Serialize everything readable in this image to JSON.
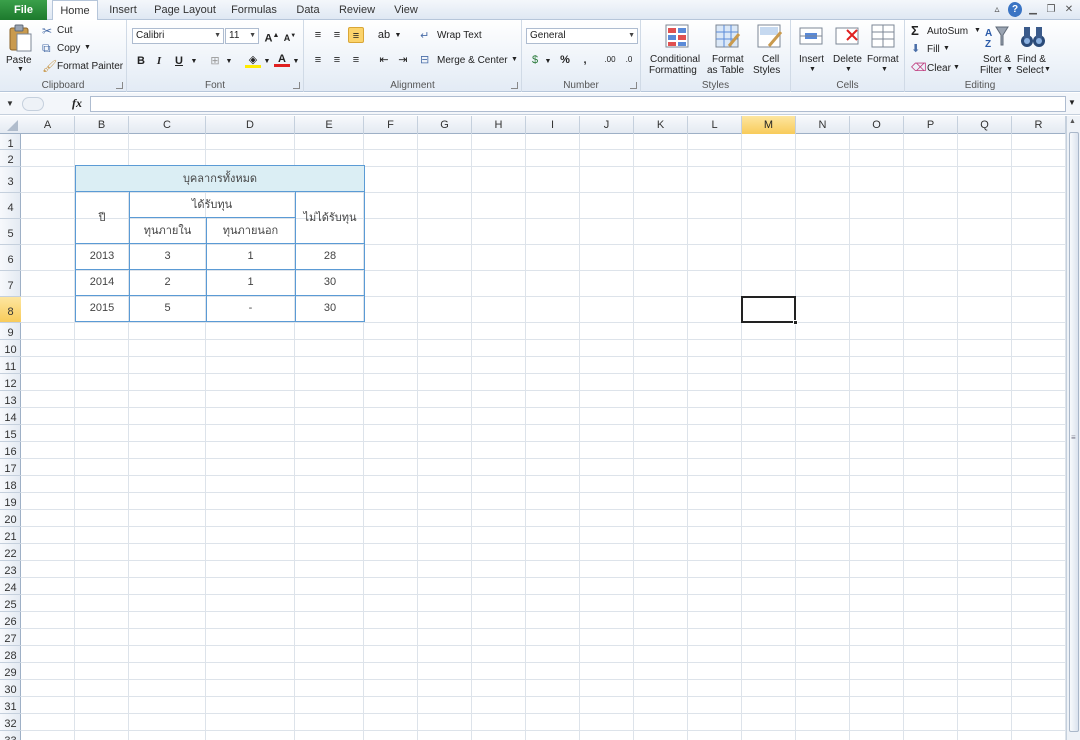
{
  "tabs": {
    "file": "File",
    "items": [
      "Home",
      "Insert",
      "Page Layout",
      "Formulas",
      "Data",
      "Review",
      "View"
    ]
  },
  "clipboard": {
    "paste": "Paste",
    "cut": "Cut",
    "copy": "Copy",
    "format_painter": "Format Painter",
    "label": "Clipboard"
  },
  "font": {
    "name": "Calibri",
    "size": "11",
    "label": "Font"
  },
  "alignment": {
    "wrap_text": "Wrap Text",
    "merge_center": "Merge & Center",
    "label": "Alignment"
  },
  "number": {
    "format": "General",
    "label": "Number"
  },
  "styles": {
    "conditional_1": "Conditional",
    "conditional_2": "Formatting",
    "format_table_1": "Format",
    "format_table_2": "as Table",
    "cell_styles_1": "Cell",
    "cell_styles_2": "Styles",
    "label": "Styles"
  },
  "cells_group": {
    "insert": "Insert",
    "delete": "Delete",
    "format": "Format",
    "label": "Cells"
  },
  "editing": {
    "autosum": "AutoSum",
    "fill": "Fill",
    "clear": "Clear",
    "sort_1": "Sort &",
    "sort_2": "Filter",
    "find_1": "Find &",
    "find_2": "Select",
    "label": "Editing"
  },
  "formula_bar": {
    "fx": "fx",
    "value": ""
  },
  "columns": [
    "A",
    "B",
    "C",
    "D",
    "E",
    "F",
    "G",
    "H",
    "I",
    "J",
    "K",
    "L",
    "M",
    "N",
    "O",
    "P",
    "Q",
    "R"
  ],
  "rows": [
    "1",
    "2",
    "3",
    "4",
    "5",
    "6",
    "7",
    "8",
    "9",
    "10",
    "11",
    "12",
    "13",
    "14",
    "15",
    "16",
    "17",
    "18",
    "19",
    "20",
    "21",
    "22",
    "23",
    "24",
    "25",
    "26",
    "27",
    "28",
    "29",
    "30",
    "31",
    "32",
    "33"
  ],
  "selected_cell": "M8",
  "table": {
    "title": "บุคลากรทั้งหมด",
    "year_header": "ปี",
    "funded_header": "ได้รับทุน",
    "internal_header": "ทุนภายใน",
    "external_header": "ทุนภายนอก",
    "unfunded_header": "ไม่ได้รับทุน",
    "rows": [
      {
        "year": "2013",
        "internal": "3",
        "external": "1",
        "unfunded": "28"
      },
      {
        "year": "2014",
        "internal": "2",
        "external": "1",
        "unfunded": "30"
      },
      {
        "year": "2015",
        "internal": "5",
        "external": "-",
        "unfunded": "30"
      }
    ]
  },
  "colors": {
    "file_tab": "#1d7a2d",
    "table_border": "#5b9bd5",
    "table_header_fill": "#dbeef4",
    "selection_header": "#f8cb5a"
  }
}
